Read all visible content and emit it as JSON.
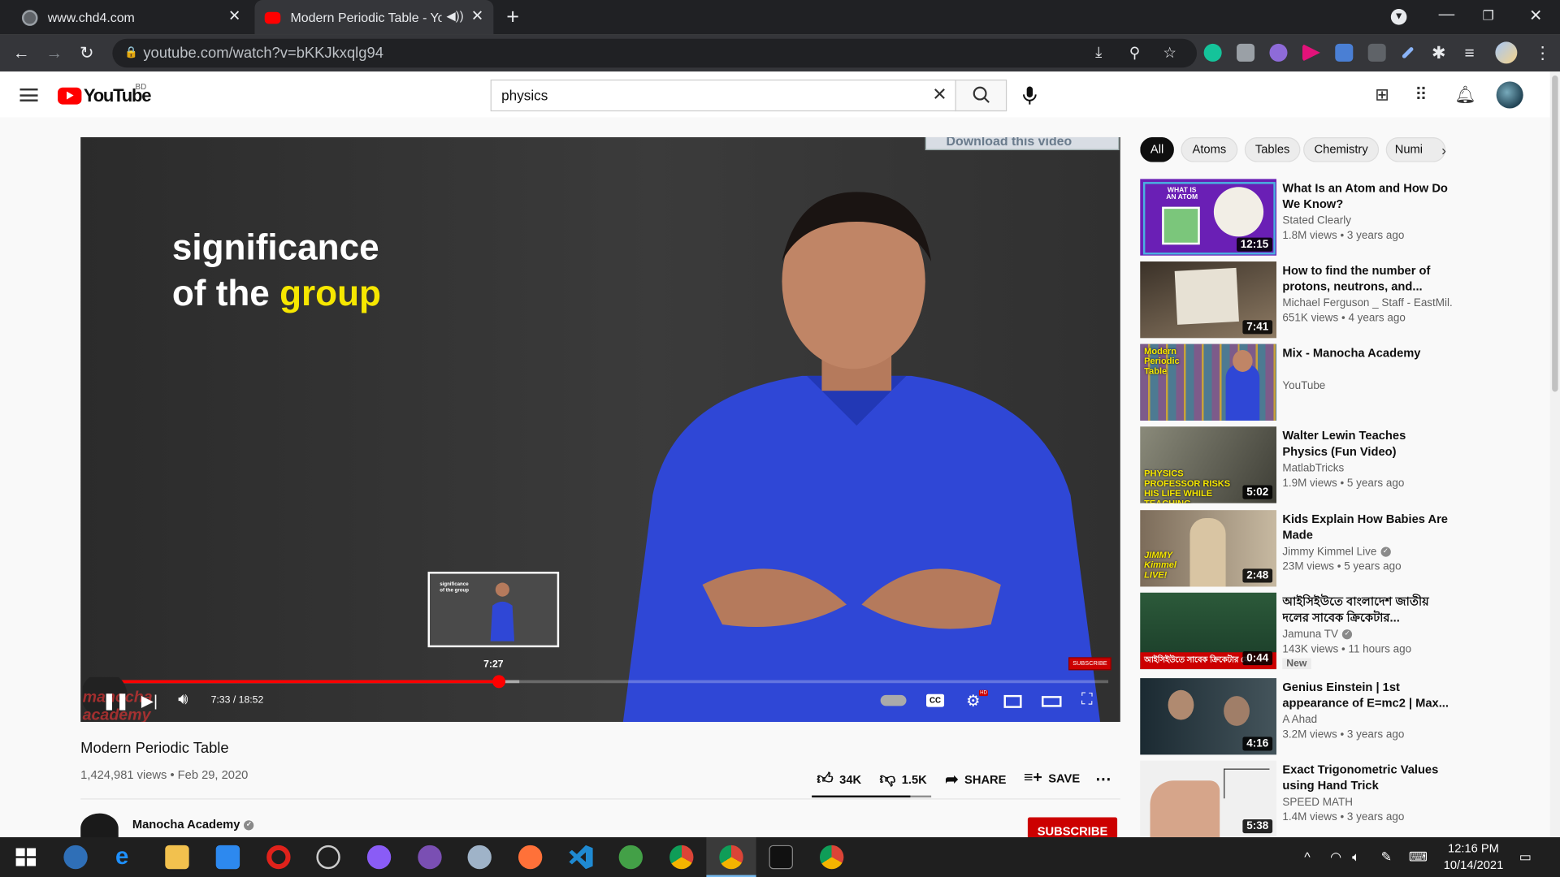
{
  "browser": {
    "tabs": [
      {
        "title": "www.chd4.com"
      },
      {
        "title": "Modern Periodic Table - You"
      }
    ],
    "url": "youtube.com/watch?v=bKKJkxqlg94"
  },
  "youtube": {
    "logo_text": "YouTube",
    "country_code": "BD",
    "search_query": "physics"
  },
  "player": {
    "download_banner": "Download this video",
    "overlay_line1": "significance",
    "overlay_line2_a": "of the ",
    "overlay_line2_b": "group",
    "preview_text_1": "significance",
    "preview_text_2": "of the group",
    "preview_time": "7:27",
    "current_time": "7:33",
    "duration": "18:52",
    "timecode": "7:33 / 18:52",
    "progress_fraction": 0.4,
    "buffered_fraction": 0.42,
    "watermark": "SUBSCRIBE",
    "channel_watermark": "manocha academy",
    "hd_badge": "HD"
  },
  "video": {
    "title": "Modern Periodic Table",
    "views_date": "1,424,981 views • Feb 29, 2020",
    "likes": "34K",
    "dislikes": "1.5K",
    "share_label": "SHARE",
    "save_label": "SAVE",
    "channel_name": "Manocha Academy",
    "subscribe_label": "SUBSCRIBE"
  },
  "chips": [
    "All",
    "Atoms",
    "Tables",
    "Chemistry",
    "Numi"
  ],
  "recommendations": [
    {
      "title": "What Is an Atom and How Do We Know?",
      "channel": "Stated Clearly",
      "meta": "1.8M views • 3 years ago",
      "duration": "12:15",
      "thumb_text": "WHAT IS AN ATOM"
    },
    {
      "title": "How to find the number of protons, neutrons, and...",
      "channel": "Michael Ferguson _ Staff - EastMil...",
      "meta": "651K views • 4 years ago",
      "duration": "7:41"
    },
    {
      "title": "Mix - Manocha Academy",
      "channel": "YouTube",
      "meta": "",
      "duration": "",
      "thumb_text": "Modern Periodic Table"
    },
    {
      "title": "Walter Lewin Teaches Physics (Fun Video)",
      "channel": "MatlabTricks",
      "meta": "1.9M views • 5 years ago",
      "duration": "5:02",
      "thumb_text": "PHYSICS PROFESSOR RISKS HIS LIFE WHILE TEACHING"
    },
    {
      "title": "Kids Explain How Babies Are Made",
      "channel": "Jimmy Kimmel Live",
      "meta": "23M views • 5 years ago",
      "duration": "2:48",
      "thumb_text": "JIMMY Kimmel LIVE!"
    },
    {
      "title": "আইসিইউতে বাংলাদেশ জাতীয় দলের সাবেক ক্রিকেটার...",
      "channel": "Jamuna TV",
      "meta": "143K views • 11 hours ago",
      "duration": "0:44",
      "badge": "New",
      "thumb_text": "আইসিইউতে সাবেক ক্রিকেটার মো"
    },
    {
      "title": "Genius Einstein | 1st appearance of E=mc2 | Max...",
      "channel": "A Ahad",
      "meta": "3.2M views • 3 years ago",
      "duration": "4:16"
    },
    {
      "title": "Exact Trigonometric Values using Hand Trick",
      "channel": "SPEED MATH",
      "meta": "1.4M views • 3 years ago",
      "duration": "5:38"
    }
  ],
  "taskbar": {
    "time": "12:16 PM",
    "date": "10/14/2021"
  },
  "colors": {
    "brand_red": "#ff0000",
    "accent_yellow": "#f6e700",
    "shirt_blue": "#2f47d6"
  }
}
